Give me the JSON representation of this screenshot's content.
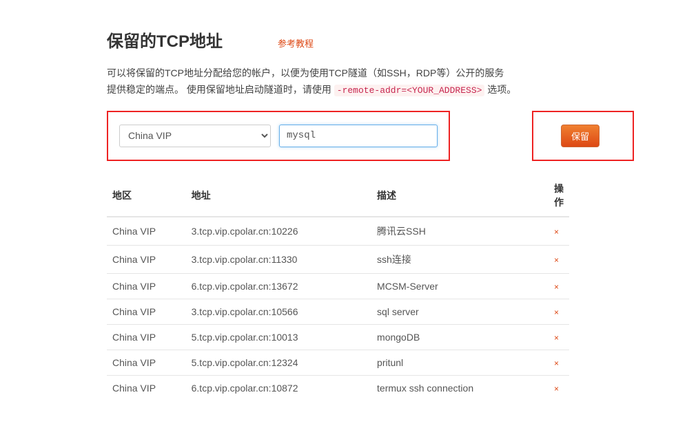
{
  "header": {
    "title": "保留的TCP地址",
    "tutorial_link": "参考教程"
  },
  "description": {
    "line1": "可以将保留的TCP地址分配给您的帐户，以便为使用TCP隧道（如SSH，RDP等）公开的服务",
    "line2_prefix": "提供稳定的端点。 使用保留地址启动隧道时，请使用 ",
    "code": "-remote-addr=<YOUR_ADDRESS>",
    "line2_suffix": " 选项。"
  },
  "form": {
    "region_selected": "China VIP",
    "desc_value": "mysql",
    "reserve_button": "保留"
  },
  "table": {
    "headers": {
      "region": "地区",
      "address": "地址",
      "description": "描述",
      "action": "操作"
    },
    "rows": [
      {
        "region": "China VIP",
        "address": "3.tcp.vip.cpolar.cn:10226",
        "description": "腾讯云SSH"
      },
      {
        "region": "China VIP",
        "address": "3.tcp.vip.cpolar.cn:11330",
        "description": "ssh连接"
      },
      {
        "region": "China VIP",
        "address": "6.tcp.vip.cpolar.cn:13672",
        "description": "MCSM-Server"
      },
      {
        "region": "China VIP",
        "address": "3.tcp.vip.cpolar.cn:10566",
        "description": "sql server"
      },
      {
        "region": "China VIP",
        "address": "5.tcp.vip.cpolar.cn:10013",
        "description": "mongoDB"
      },
      {
        "region": "China VIP",
        "address": "5.tcp.vip.cpolar.cn:12324",
        "description": "pritunl"
      },
      {
        "region": "China VIP",
        "address": "6.tcp.vip.cpolar.cn:10872",
        "description": "termux ssh connection"
      }
    ],
    "delete_symbol": "×"
  }
}
